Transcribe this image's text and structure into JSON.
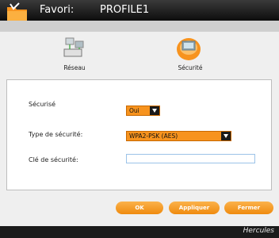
{
  "header": {
    "favorites_label": "Favori:",
    "profile_name": "PROFILE1"
  },
  "nav": {
    "network_label": "Réseau",
    "security_label": "Sécurité"
  },
  "form": {
    "secured_label": "Sécurisé",
    "secured_value": "Oui",
    "security_type_label": "Type de sécurité:",
    "security_type_value": "WPA2-PSK (AES)",
    "security_key_label": "Clé de sécurité:",
    "security_key_value": ""
  },
  "buttons": {
    "ok": "OK",
    "apply": "Appliquer",
    "close": "Fermer"
  },
  "footer": {
    "brand": "Hercules"
  },
  "colors": {
    "accent": "#f7931e",
    "titlebar": "#1a1a1a"
  }
}
